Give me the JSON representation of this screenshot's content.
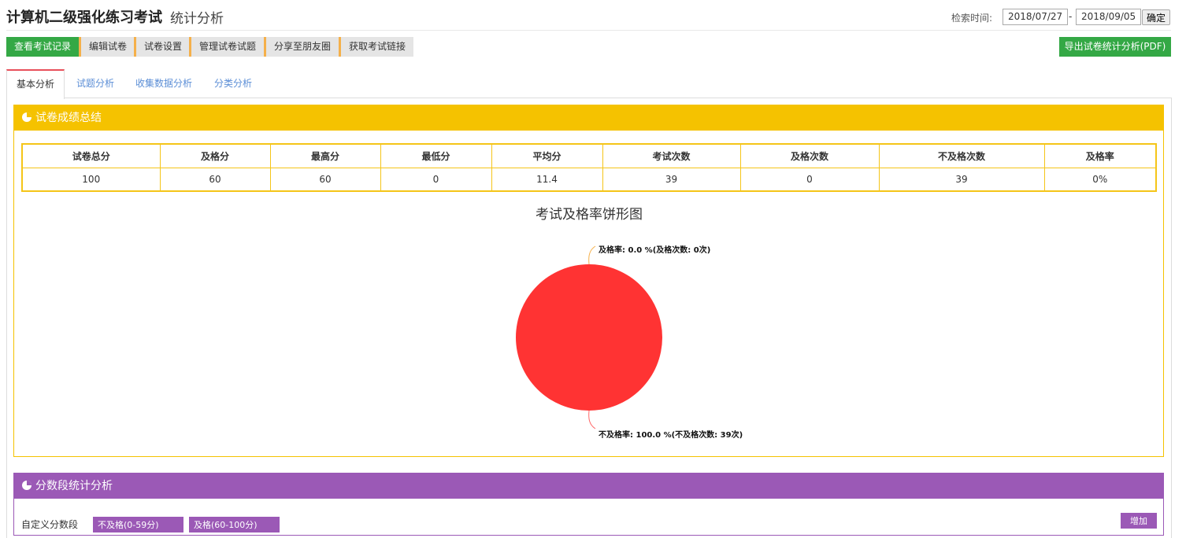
{
  "header": {
    "title": "计算机二级强化练习考试",
    "subtitle": "统计分析",
    "search_label": "检索时间:",
    "date_from": "2018/07/27",
    "date_sep": "-",
    "date_to": "2018/09/05",
    "confirm": "确定"
  },
  "toolbar": {
    "buttons": [
      "查看考试记录",
      "编辑试卷",
      "试卷设置",
      "管理试卷试题",
      "分享至朋友圈",
      "获取考试链接"
    ],
    "export": "导出试卷统计分析(PDF)"
  },
  "tabs": [
    "基本分析",
    "试题分析",
    "收集数据分析",
    "分类分析"
  ],
  "summary": {
    "title": "试卷成绩总结",
    "color": "#f5c200",
    "headers": [
      "试卷总分",
      "及格分",
      "最高分",
      "最低分",
      "平均分",
      "考试次数",
      "及格次数",
      "不及格次数",
      "及格率"
    ],
    "values": [
      "100",
      "60",
      "60",
      "0",
      "11.4",
      "39",
      "0",
      "39",
      "0%"
    ]
  },
  "chart_data": {
    "type": "pie",
    "title": "考试及格率饼形图",
    "slices": [
      {
        "label": "及格率: 0.0 %(及格次数: 0次)",
        "value": 0,
        "color": "#f5b04a"
      },
      {
        "label": "不及格率: 100.0 %(不及格次数: 39次)",
        "value": 100,
        "color": "#ff3333"
      }
    ]
  },
  "score_bands": {
    "title": "分数段统计分析",
    "color": "#9b59b6",
    "label": "自定义分数段",
    "tags": [
      "不及格(0-59分)",
      "及格(60-100分)"
    ],
    "add": "增加"
  }
}
